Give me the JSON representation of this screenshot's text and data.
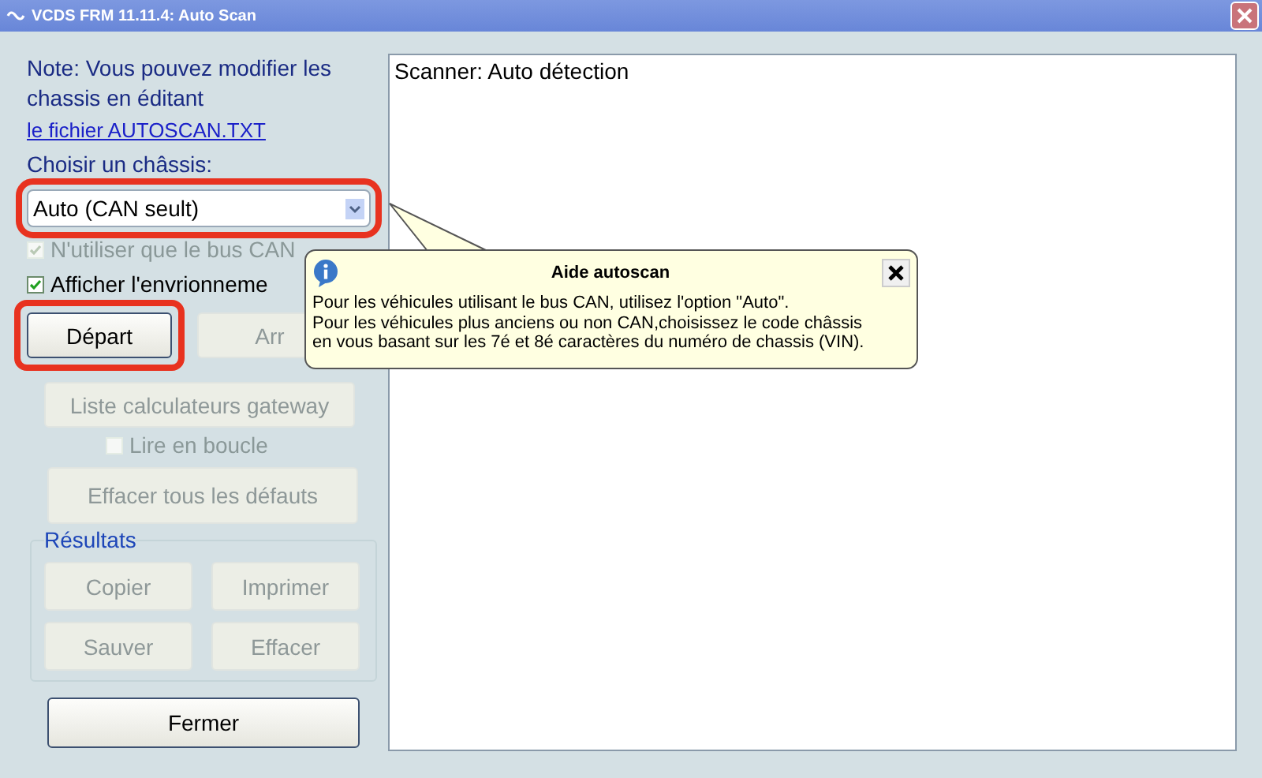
{
  "window": {
    "title": "VCDS FRM 11.11.4:  Auto Scan"
  },
  "note": "Note:  Vous pouvez modifier les chassis en éditant",
  "file_link": "le fichier AUTOSCAN.TXT",
  "chassis_label": "Choisir un châssis:",
  "chassis_select": {
    "value": "Auto (CAN seult)",
    "highlighted": true
  },
  "options": [
    {
      "label": "N'utiliser que le bus CAN",
      "checked": true,
      "disabled": true
    },
    {
      "label": "Afficher l'envrionneme",
      "checked": true,
      "disabled": false
    }
  ],
  "start_buttons": [
    {
      "label": "Départ",
      "disabled": false,
      "highlighted": true
    },
    {
      "label": "Arr",
      "disabled": true,
      "highlighted": false
    }
  ],
  "gateway_button": {
    "label": "Liste calculateurs gateway",
    "disabled": true
  },
  "loop_option": {
    "label": "Lire en boucle",
    "checked": false,
    "disabled": true
  },
  "clear_button": {
    "label": "Effacer tous les défauts",
    "disabled": true
  },
  "results": {
    "title": "Résultats",
    "buttons": [
      {
        "label": "Copier",
        "disabled": true
      },
      {
        "label": "Imprimer",
        "disabled": true
      },
      {
        "label": "Sauver",
        "disabled": true
      },
      {
        "label": "Effacer",
        "disabled": true
      }
    ]
  },
  "close_button": {
    "label": "Fermer",
    "disabled": false
  },
  "output": {
    "text": "Scanner: Auto détection"
  },
  "tooltip": {
    "title": "Aide autoscan",
    "lines": [
      "Pour les véhicules utilisant le bus CAN, utilisez l'option \"Auto\".",
      "Pour les véhicules plus anciens ou non CAN,choisissez le code châssis",
      "en vous basant sur les 7é et 8é caractères du numéro de chassis (VIN)."
    ]
  }
}
